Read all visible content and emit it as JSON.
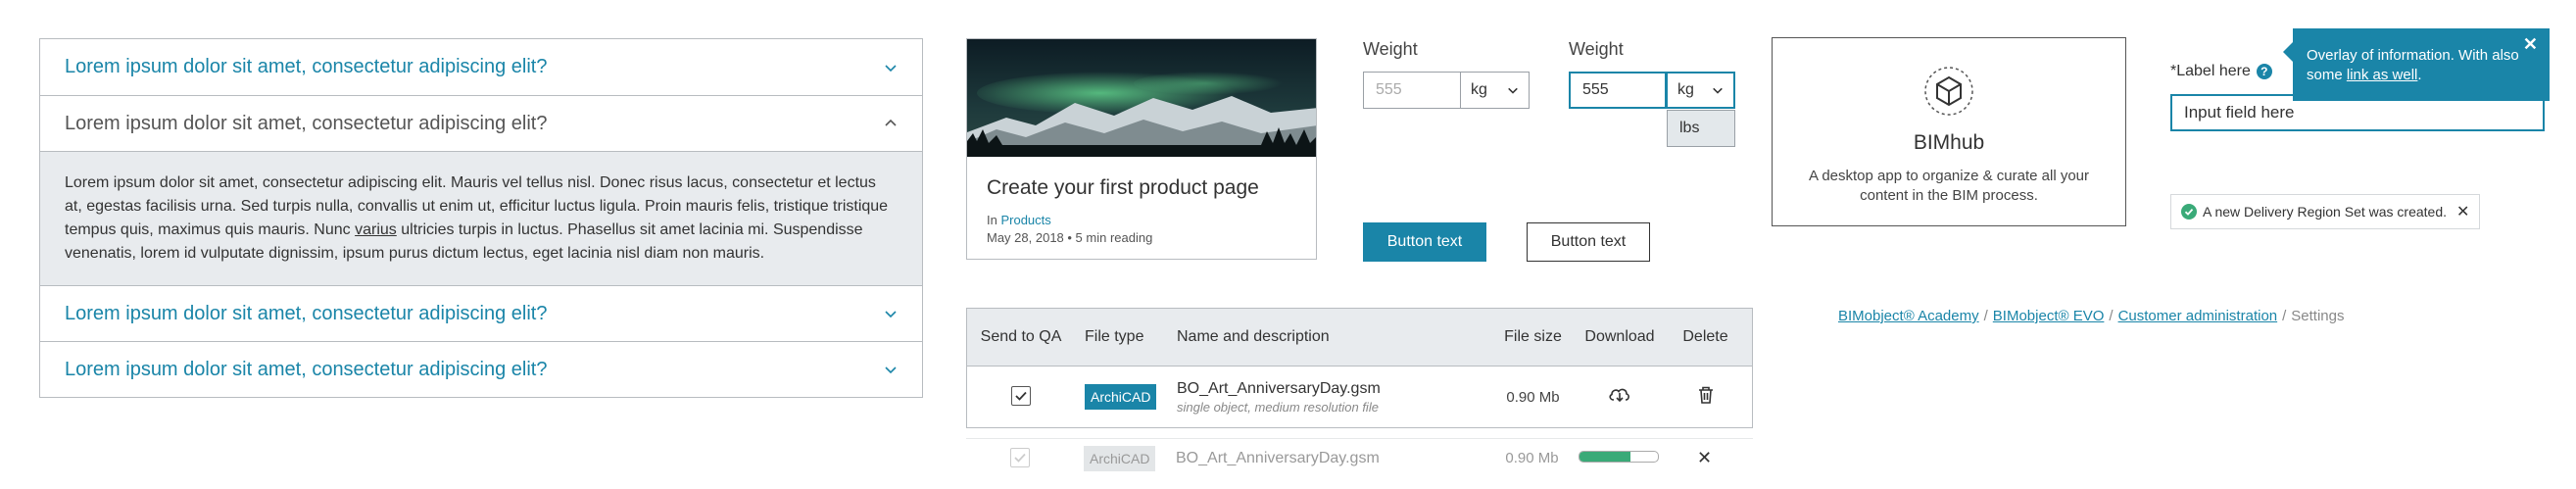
{
  "accordion": {
    "items": [
      {
        "title": "Lorem ipsum dolor sit amet, consectetur adipiscing elit?",
        "open": false
      },
      {
        "title": "Lorem ipsum dolor sit amet, consectetur adipiscing elit?",
        "open": true,
        "body_before": "Lorem ipsum dolor sit amet, consectetur adipiscing elit. Mauris vel tellus nisl. Donec risus lacus, consectetur et lectus at, egestas facilisis urna. Sed turpis nulla, convallis ut enim ut, efficitur luctus ligula. Proin mauris felis, tristique tristique tempus quis, maximus quis mauris. Nunc ",
        "body_link": "varius",
        "body_after": " ultricies turpis in luctus. Phasellus sit amet lacinia mi. Suspendisse venenatis, lorem id vulputate dignissim, ipsum purus dictum lectus, eget lacinia nisl diam non mauris."
      },
      {
        "title": "Lorem ipsum dolor sit amet, consectetur adipiscing elit?",
        "open": false
      },
      {
        "title": "Lorem ipsum dolor sit amet, consectetur adipiscing elit?",
        "open": false
      }
    ]
  },
  "card": {
    "title": "Create your first product page",
    "in_prefix": "In",
    "category": "Products",
    "meta": "May 28, 2018 • 5 min reading"
  },
  "weight1": {
    "label": "Weight",
    "placeholder": "555",
    "unit": "kg"
  },
  "weight2": {
    "label": "Weight",
    "value": "555",
    "unit": "kg",
    "dropdown_option": "lbs"
  },
  "buttons": {
    "primary": "Button text",
    "secondary": "Button text"
  },
  "bimhub": {
    "name": "BIMhub",
    "description": "A desktop app to organize & curate all your content in the BIM process."
  },
  "label_field": {
    "label": "*Label here",
    "value": "Input field here"
  },
  "tooltip": {
    "text": "Overlay of information. With also some",
    "link": "link as well",
    "end": "."
  },
  "toast": {
    "text": "A new Delivery Region Set was created."
  },
  "breadcrumb": {
    "items": [
      "BIMobject® Academy",
      "BIMobject® EVO",
      "Customer administration"
    ],
    "current": "Settings"
  },
  "table": {
    "headers": [
      "Send to QA",
      "File type",
      "Name and description",
      "File size",
      "Download",
      "Delete"
    ],
    "rows": [
      {
        "tag": "ArchiCAD",
        "name": "BO_Art_AnniversaryDay.gsm",
        "desc": "single object, medium resolution file",
        "size": "0.90 Mb"
      },
      {
        "tag": "ArchiCAD",
        "name": "BO_Art_AnniversaryDay.gsm",
        "size": "0.90 Mb",
        "progress": 0.65
      }
    ]
  },
  "colors": {
    "accent": "#1a85a8",
    "success": "#3aaa78"
  }
}
